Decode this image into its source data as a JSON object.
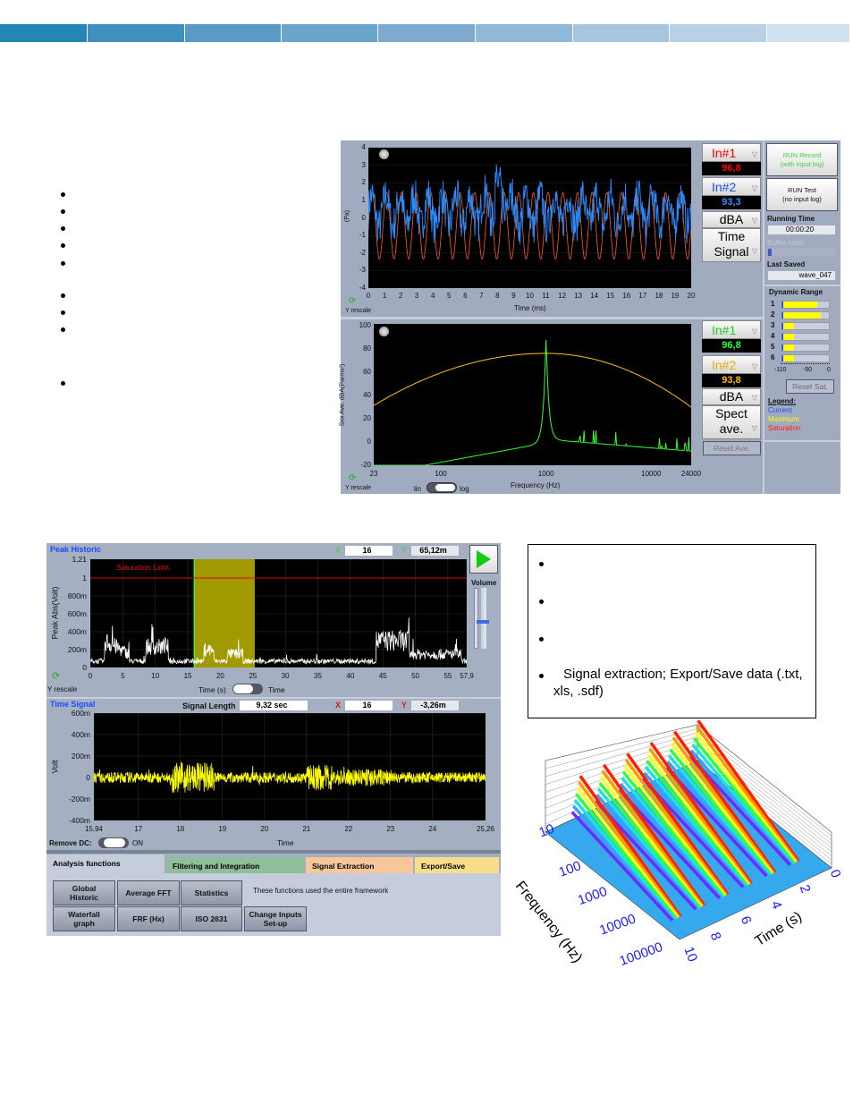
{
  "banner": {
    "colors": [
      "#2586b5",
      "#4090bd",
      "#589bc5",
      "#6aa5cb",
      "#7eaad0",
      "#90b8d8",
      "#a6c6df",
      "#b9d1e6",
      "#cfe0ef"
    ]
  },
  "left_bullets": [
    "",
    "",
    "",
    "",
    "",
    "",
    "",
    "",
    ""
  ],
  "top_app": {
    "time_plot": {
      "ylabel": "(Pa)",
      "xlabel": "Time (ms)",
      "yticks": [
        "4",
        "3",
        "2",
        "1",
        "0",
        "-1",
        "-2",
        "-3",
        "-4"
      ],
      "xticks": [
        "0",
        "1",
        "2",
        "3",
        "4",
        "5",
        "6",
        "7",
        "8",
        "9",
        "10",
        "11",
        "12",
        "13",
        "14",
        "15",
        "16",
        "17",
        "18",
        "19",
        "20"
      ],
      "rescale": "Y rescale",
      "series_colors": {
        "in1": "#ff5a1e",
        "in2": "#2a8cff"
      }
    },
    "spec_plot": {
      "ylabel": "Sxx Ave. dBA(Parms²)",
      "xlabel": "Frequency (Hz)",
      "yticks": [
        "100",
        "80",
        "60",
        "40",
        "20",
        "0",
        "-20"
      ],
      "xticks": [
        "23",
        "100",
        "1000",
        "10000",
        "24000"
      ],
      "rescale": "Y rescale",
      "toggle_lin": "lin",
      "toggle_log": "log",
      "series_colors": {
        "in1": "#30ff30",
        "in2": "#ffc000"
      }
    },
    "controls_top": {
      "in1": "In#1",
      "in1_val": "96,8",
      "in2": "In#2",
      "in2_val": "93,3",
      "unit": "dBA",
      "mode_line1": "Time",
      "mode_line2": "Signal"
    },
    "controls_bottom": {
      "in1": "In#1",
      "in1_val": "96,8",
      "in2": "In#2",
      "in2_val": "93,8",
      "unit": "dBA",
      "mode_line1": "Spect",
      "mode_line2": "ave.",
      "reset": "Reset Ave."
    },
    "status": {
      "run_record": "RUN Record",
      "run_record_sub": "(with input log)",
      "run_test": "RUN Test",
      "run_test_sub": "(no input log)",
      "running_time_label": "Running Time",
      "running_time": "00:00:20",
      "buffer_label": "Buffer state",
      "buffer_fill": 0.05,
      "last_saved_label": "Last Saved",
      "last_saved": "wave_047"
    },
    "dynamic_range": {
      "title": "Dynamic Range",
      "channels": [
        "1",
        "2",
        "3",
        "4",
        "5",
        "6"
      ],
      "levels_db": [
        -28,
        -21,
        -82,
        -82,
        -82,
        -82
      ],
      "scale": [
        "-110",
        "-50",
        "0"
      ],
      "reset": "Reset Sat.",
      "legend_title": "Legend:",
      "legend": [
        {
          "label": "Current",
          "color": "#1a4dff"
        },
        {
          "label": "Maximum",
          "color": "#ffff00"
        },
        {
          "label": "Saturation",
          "color": "#ff1a1a"
        }
      ]
    }
  },
  "bottom_app": {
    "peak": {
      "title": "Peak Historic",
      "x_label": "X",
      "x_val": "16",
      "y_label": "Y",
      "y_val": "65,12m",
      "ylabel": "Peak Abs(Volt)",
      "yticks": [
        "1,21",
        "1",
        "800m",
        "600m",
        "400m",
        "200m",
        "0"
      ],
      "xticks": [
        "0",
        "5",
        "10",
        "15",
        "20",
        "25",
        "30",
        "35",
        "40",
        "45",
        "50",
        "55",
        "57,9"
      ],
      "saturation": "Saturation Limit",
      "xlabel": "Time (s)",
      "toggle_label": "Time",
      "rescale": "Y rescale",
      "selection": [
        16,
        25.3
      ],
      "volume": "Volume"
    },
    "signal": {
      "title": "Time Signal",
      "length_label": "Signal Length",
      "length": "9,32 sec",
      "x_label": "X",
      "x_val": "16",
      "y_label": "Y",
      "y_val": "-3,26m",
      "ylabel": "Volt",
      "yticks": [
        "600m",
        "400m",
        "200m",
        "0",
        "-200m",
        "-400m"
      ],
      "xticks": [
        "15,94",
        "17",
        "18",
        "19",
        "20",
        "21",
        "22",
        "23",
        "24",
        "25,26"
      ],
      "xlabel": "Time",
      "remove_dc": "Remove DC:",
      "dc_state": "ON"
    },
    "tabs": [
      {
        "label": "Analysis functions",
        "color": "#c5ccdb"
      },
      {
        "label": "Filtering and Integration",
        "color": "#8fbf9a"
      },
      {
        "label": "Signal Extraction",
        "color": "#f7c79a"
      },
      {
        "label": "Export/Save",
        "color": "#f9dd8a"
      }
    ],
    "buttons": [
      [
        "Global",
        "Historic"
      ],
      [
        "Average FFT"
      ],
      [
        "Statistics"
      ],
      [
        "Waterfall",
        "graph"
      ],
      [
        "FRF (Hx)"
      ],
      [
        "ISO 2631"
      ],
      [
        "Change Inputs",
        "Set-up"
      ]
    ],
    "note": "These functions used the entire framework"
  },
  "box_bullets": [
    "",
    "",
    "",
    "Signal extraction; Export/Save data (.txt, xls, .sdf)"
  ],
  "waterfall": {
    "freq_label": "Frequency (Hz)",
    "time_label": "Time (s)",
    "freq_ticks": [
      "10",
      "100",
      "1000",
      "10000",
      "100000"
    ],
    "time_ticks": [
      "0",
      "2",
      "4",
      "6",
      "8",
      "10"
    ]
  }
}
